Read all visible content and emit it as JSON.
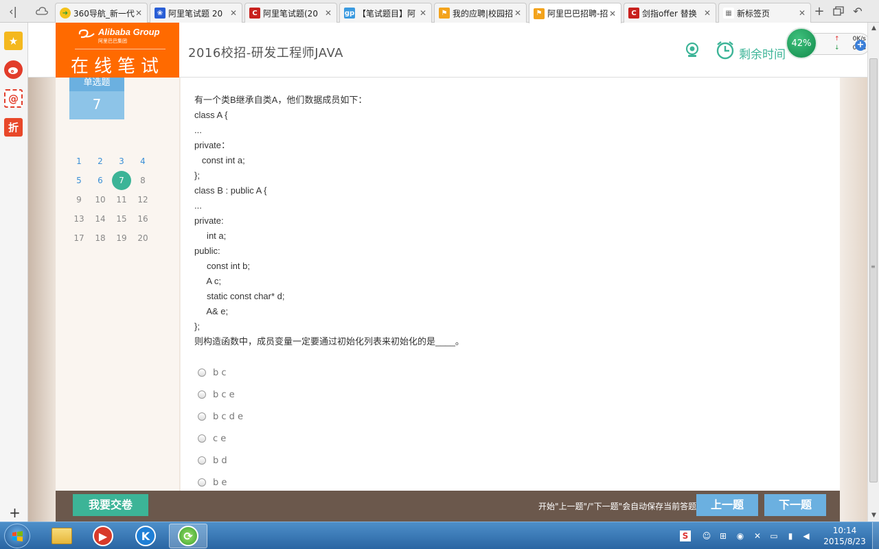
{
  "browser": {
    "tabs": [
      {
        "title": "360导航_新一代",
        "favicon": "360-icon",
        "color": "#2e9d3a"
      },
      {
        "title": "阿里笔试题 20",
        "favicon": "paw-icon",
        "color": "#2a5fd6"
      },
      {
        "title": "阿里笔试题(20",
        "favicon": "csdn-c-icon",
        "color": "#c8211e"
      },
      {
        "title": "【笔试题目】阿",
        "favicon": "gp-icon",
        "color": "#3a9ae0"
      },
      {
        "title": "我的应聘|校园招",
        "favicon": "alibaba-flag-icon",
        "color": "#f3a31c"
      },
      {
        "title": "阿里巴巴招聘-招",
        "favicon": "alibaba-flag-icon",
        "color": "#f3a31c",
        "active": true
      },
      {
        "title": "剑指offer 替换",
        "favicon": "csdn-c-icon",
        "color": "#c8211e"
      },
      {
        "title": "新标签页",
        "favicon": "grid-icon",
        "color": "#7a7a7a"
      }
    ],
    "left_icons": [
      "star-icon",
      "weibo-icon",
      "mail-at-icon",
      "discount-icon"
    ],
    "left_icon_labels": {
      "mail": "@",
      "discount": "折"
    },
    "left_add": "+"
  },
  "header": {
    "logo_brand": "Alibaba Group",
    "logo_sub": "阿里巴巴集团",
    "logo_title": "在线笔试",
    "exam_title": "2016校招-研发工程师JAVA",
    "time_label": "剩余时间"
  },
  "speed_widget": {
    "percent": "42%",
    "upload": "0K/s",
    "download": "0K/s"
  },
  "question_panel": {
    "type_label": "单选题",
    "current_number": "7",
    "grid": [
      "1",
      "2",
      "3",
      "4",
      "5",
      "6",
      "7",
      "8",
      "9",
      "10",
      "11",
      "12",
      "13",
      "14",
      "15",
      "16",
      "17",
      "18",
      "19",
      "20"
    ],
    "answered": [
      1,
      2,
      3,
      4,
      5,
      6
    ],
    "current": 7
  },
  "question": {
    "lines": [
      "有一个类B继承自类A，他们数据成员如下：",
      "class A {",
      "...",
      "private：",
      "   const int a;",
      "};",
      "class B : public A {",
      "...",
      "private:",
      "     int a;",
      "public:",
      "     const int b;",
      "     A c;",
      "     static const char* d;",
      "     A& e;",
      "};",
      "则构造函数中，成员变量一定要通过初始化列表来初始化的是____。"
    ],
    "options": [
      "b c",
      "b c e",
      "b c d e",
      "c e",
      "b d",
      "b e"
    ]
  },
  "footer": {
    "submit_label": "我要交卷",
    "note": "开始\"上一题\"/\"下一题\"会自动保存当前答题",
    "prev_label": "上一题",
    "next_label": "下一题"
  },
  "taskbar": {
    "time": "10:14",
    "date": "2015/8/23"
  },
  "colors": {
    "accent_orange": "#ff6a00",
    "accent_green": "#3cb497",
    "accent_blue": "#6bb0e0",
    "footer_brown": "#6b584c"
  }
}
